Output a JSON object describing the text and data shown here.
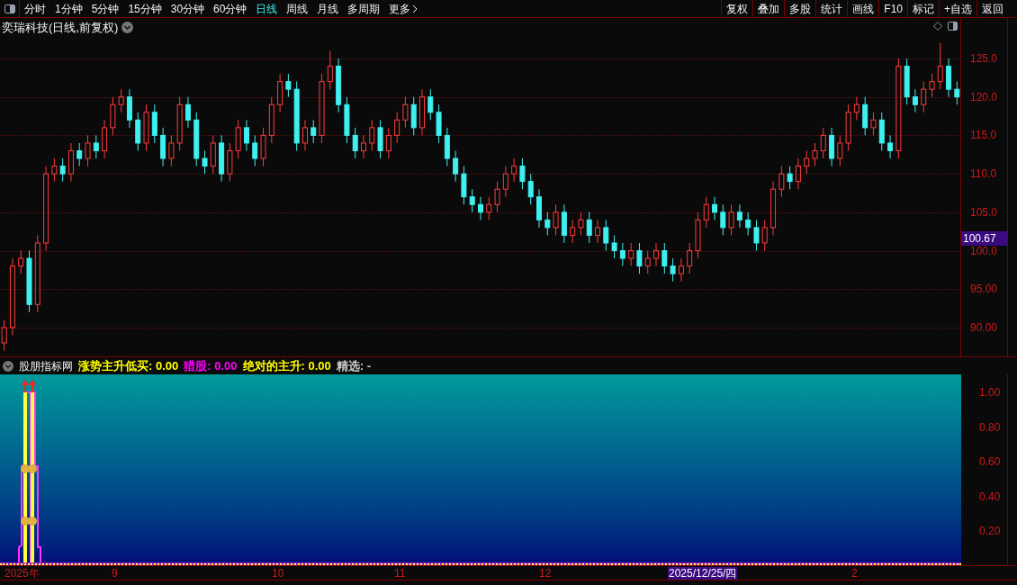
{
  "toolbar": {
    "periods": [
      {
        "label": "分时",
        "selected": false
      },
      {
        "label": "1分钟",
        "selected": false
      },
      {
        "label": "5分钟",
        "selected": false
      },
      {
        "label": "15分钟",
        "selected": false
      },
      {
        "label": "30分钟",
        "selected": false
      },
      {
        "label": "60分钟",
        "selected": false
      },
      {
        "label": "日线",
        "selected": true
      },
      {
        "label": "周线",
        "selected": false
      },
      {
        "label": "月线",
        "selected": false
      },
      {
        "label": "多周期",
        "selected": false
      },
      {
        "label": "更多",
        "selected": false
      }
    ],
    "actions": [
      "复权",
      "叠加",
      "多股",
      "统计",
      "画线",
      "F10",
      "标记",
      "+自选",
      "返回"
    ]
  },
  "main_chart": {
    "title": "奕瑞科技(日线,前复权)",
    "current_price": "100.67",
    "chart_data": {
      "type": "candlestick",
      "grid": true,
      "ylim": [
        86.36,
        130.27
      ],
      "categories": [
        null,
        null,
        null,
        null,
        null,
        null,
        null,
        null,
        null,
        null,
        null,
        null,
        null,
        null,
        null,
        null,
        null,
        null,
        null,
        null,
        null,
        null,
        null,
        null,
        null,
        null,
        null,
        null,
        null,
        null,
        null,
        null,
        null,
        null,
        null,
        null,
        null,
        null,
        null,
        null,
        null,
        null,
        null,
        null,
        null,
        null,
        null,
        null,
        null,
        null,
        null,
        null,
        null,
        null,
        null,
        null,
        null,
        null,
        null,
        null,
        null,
        null,
        null,
        null,
        null,
        null,
        null,
        null,
        null,
        null,
        null,
        null,
        null,
        null,
        null,
        null,
        null,
        null,
        null,
        null,
        null,
        null,
        null,
        null,
        null,
        null,
        null,
        null,
        null,
        null,
        null,
        null,
        null,
        null,
        null,
        null,
        null,
        null,
        null,
        null,
        null,
        null,
        null,
        null,
        null,
        null,
        null,
        null,
        null,
        null,
        null,
        null,
        null,
        null,
        null
      ],
      "ohlc": [
        [
          88,
          91,
          87,
          90
        ],
        [
          90,
          99,
          89,
          98
        ],
        [
          98,
          100,
          97,
          99
        ],
        [
          99,
          100,
          92,
          93
        ],
        [
          93,
          102,
          92,
          101
        ],
        [
          101,
          111,
          100,
          110
        ],
        [
          110,
          112,
          109,
          111
        ],
        [
          111,
          112,
          109,
          110
        ],
        [
          110,
          114,
          109,
          113
        ],
        [
          113,
          114,
          111,
          112
        ],
        [
          112,
          115,
          111,
          114
        ],
        [
          114,
          115,
          112,
          113
        ],
        [
          113,
          117,
          112,
          116
        ],
        [
          116,
          120,
          115,
          119
        ],
        [
          119,
          121,
          118,
          120
        ],
        [
          120,
          121,
          116,
          117
        ],
        [
          117,
          118,
          113,
          114
        ],
        [
          114,
          119,
          113,
          118
        ],
        [
          118,
          119,
          114,
          115
        ],
        [
          115,
          116,
          111,
          112
        ],
        [
          112,
          115,
          111,
          114
        ],
        [
          114,
          120,
          113,
          119
        ],
        [
          119,
          120,
          116,
          117
        ],
        [
          117,
          118,
          111,
          112
        ],
        [
          112,
          113,
          110,
          111
        ],
        [
          111,
          115,
          110,
          114
        ],
        [
          114,
          115,
          109,
          110
        ],
        [
          110,
          114,
          109,
          113
        ],
        [
          113,
          117,
          112,
          116
        ],
        [
          116,
          117,
          113,
          114
        ],
        [
          114,
          115,
          111,
          112
        ],
        [
          112,
          116,
          111,
          115
        ],
        [
          115,
          120,
          114,
          119
        ],
        [
          119,
          123,
          118,
          122
        ],
        [
          122,
          123,
          120,
          121
        ],
        [
          121,
          122,
          113,
          114
        ],
        [
          114,
          117,
          113,
          116
        ],
        [
          116,
          117,
          114,
          115
        ],
        [
          115,
          123,
          114,
          122
        ],
        [
          122,
          126,
          121,
          124
        ],
        [
          124,
          125,
          118,
          119
        ],
        [
          119,
          120,
          114,
          115
        ],
        [
          115,
          116,
          112,
          113
        ],
        [
          113,
          115,
          112,
          114
        ],
        [
          114,
          117,
          113,
          116
        ],
        [
          116,
          117,
          112,
          113
        ],
        [
          113,
          116,
          112,
          115
        ],
        [
          115,
          118,
          114,
          117
        ],
        [
          117,
          120,
          116,
          119
        ],
        [
          119,
          120,
          115,
          116
        ],
        [
          116,
          121,
          115,
          120
        ],
        [
          120,
          121,
          117,
          118
        ],
        [
          118,
          119,
          114,
          115
        ],
        [
          115,
          116,
          111,
          112
        ],
        [
          112,
          113,
          109,
          110
        ],
        [
          110,
          111,
          106,
          107
        ],
        [
          107,
          108,
          105,
          106
        ],
        [
          106,
          107,
          104,
          105
        ],
        [
          105,
          107,
          104,
          106
        ],
        [
          106,
          109,
          105,
          108
        ],
        [
          108,
          111,
          107,
          110
        ],
        [
          110,
          112,
          109,
          111
        ],
        [
          111,
          112,
          108,
          109
        ],
        [
          109,
          110,
          106,
          107
        ],
        [
          107,
          108,
          103,
          104
        ],
        [
          104,
          105,
          102,
          103
        ],
        [
          103,
          106,
          102,
          105
        ],
        [
          105,
          106,
          101,
          102
        ],
        [
          102,
          104,
          101,
          103
        ],
        [
          103,
          105,
          102,
          104
        ],
        [
          104,
          105,
          101,
          102
        ],
        [
          102,
          104,
          101,
          103
        ],
        [
          103,
          104,
          100,
          101
        ],
        [
          101,
          102,
          99,
          100
        ],
        [
          100,
          101,
          98,
          99
        ],
        [
          99,
          101,
          98,
          100
        ],
        [
          100,
          101,
          97,
          98
        ],
        [
          98,
          100,
          97,
          99
        ],
        [
          99,
          101,
          98,
          100
        ],
        [
          100,
          101,
          97,
          98
        ],
        [
          98,
          99,
          96,
          97
        ],
        [
          97,
          99,
          96,
          98
        ],
        [
          98,
          101,
          97,
          100
        ],
        [
          100,
          105,
          99,
          104
        ],
        [
          104,
          107,
          103,
          106
        ],
        [
          106,
          107,
          104,
          105
        ],
        [
          105,
          106,
          102,
          103
        ],
        [
          103,
          106,
          102,
          105
        ],
        [
          105,
          106,
          103,
          104
        ],
        [
          104,
          105,
          102,
          103
        ],
        [
          103,
          104,
          100,
          101
        ],
        [
          101,
          104,
          100,
          103
        ],
        [
          103,
          109,
          102,
          108
        ],
        [
          108,
          111,
          107,
          110
        ],
        [
          110,
          111,
          108,
          109
        ],
        [
          109,
          112,
          108,
          111
        ],
        [
          111,
          113,
          110,
          112
        ],
        [
          112,
          114,
          111,
          113
        ],
        [
          113,
          116,
          112,
          115
        ],
        [
          115,
          116,
          111,
          112
        ],
        [
          112,
          115,
          111,
          114
        ],
        [
          114,
          119,
          113,
          118
        ],
        [
          118,
          120,
          117,
          119
        ],
        [
          119,
          120,
          115,
          116
        ],
        [
          116,
          118,
          115,
          117
        ],
        [
          117,
          118,
          113,
          114
        ],
        [
          114,
          115,
          112,
          113
        ],
        [
          113,
          125,
          112,
          124
        ],
        [
          124,
          125,
          119,
          120
        ],
        [
          120,
          121,
          118,
          119
        ],
        [
          119,
          122,
          118,
          121
        ],
        [
          121,
          123,
          120,
          122
        ],
        [
          122,
          127,
          121,
          124
        ],
        [
          124,
          125,
          120,
          121
        ],
        [
          121,
          122,
          119,
          120
        ]
      ],
      "yticks": [
        {
          "value": 125,
          "label": "125.0"
        },
        {
          "value": 120,
          "label": "120.0"
        },
        {
          "value": 115,
          "label": "115.0"
        },
        {
          "value": 110,
          "label": "110.0"
        },
        {
          "value": 105,
          "label": "105.0"
        },
        {
          "value": 100,
          "label": "100.0"
        },
        {
          "value": 95,
          "label": "95.00"
        },
        {
          "value": 90,
          "label": "90.00"
        }
      ]
    }
  },
  "indicator": {
    "name": "股朋指标网",
    "values": [
      {
        "label": "涨势主升低买: 0.00",
        "color": "#ffff00"
      },
      {
        "label": "猎股: 0.00",
        "color": "#ff00ff"
      },
      {
        "label": "绝对的主升: 0.00",
        "color": "#ffff00"
      },
      {
        "label": "精选: -",
        "color": "#d0d0d0"
      }
    ],
    "ticks": [
      "1.00",
      "0.80",
      "0.60",
      "0.40",
      "0.20"
    ]
  },
  "date_axis": [
    {
      "label": "2025年",
      "selected": false
    },
    {
      "label": "9",
      "selected": false
    },
    {
      "label": "10",
      "selected": false
    },
    {
      "label": "11",
      "selected": false
    },
    {
      "label": "12",
      "selected": false
    },
    {
      "label": "2025/12/25/四",
      "selected": true
    },
    {
      "label": "2",
      "selected": false
    }
  ]
}
